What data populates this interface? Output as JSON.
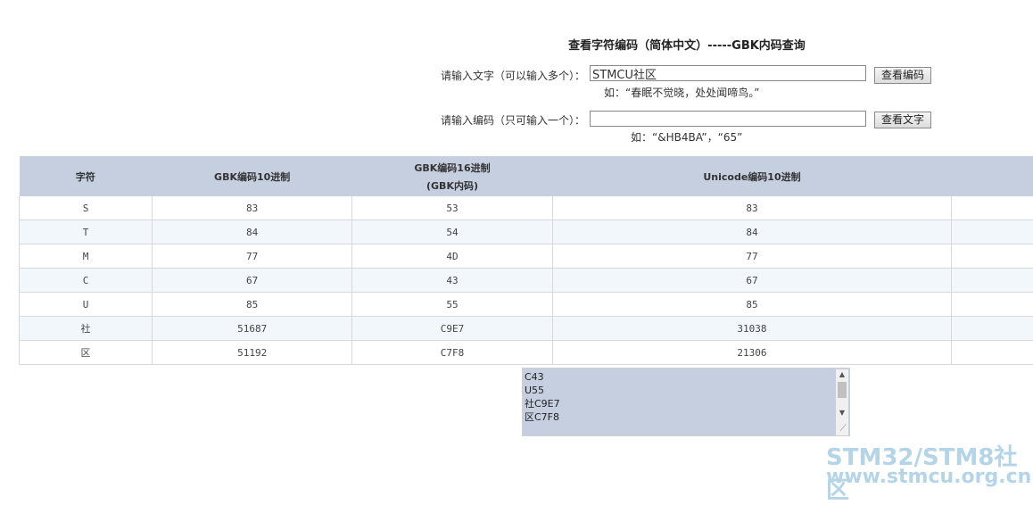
{
  "page": {
    "title": "查看字符编码（简体中文）-----GBK内码查询"
  },
  "form": {
    "text_label": "请输入文字（可以输入多个）：",
    "text_value": "STMCU社区",
    "text_button": "查看编码",
    "text_hint": "如：“春眠不觉晓，处处闻啼鸟。”",
    "code_label": "请输入编码（只可输入一个）：",
    "code_value": "",
    "code_button": "查看文字",
    "code_hint": "如：“&HB4BA”，“65”"
  },
  "table": {
    "headers": {
      "char": "字符",
      "gbk10": "GBK编码10进制",
      "gbk16_line1": "GBK编码16进制",
      "gbk16_line2": "(GBK内码)",
      "unicode10": "Unicode编码10进制",
      "extra": ""
    },
    "rows": [
      {
        "char": "S",
        "gbk10": "83",
        "gbk16": "53",
        "unicode10": "83"
      },
      {
        "char": "T",
        "gbk10": "84",
        "gbk16": "54",
        "unicode10": "84"
      },
      {
        "char": "M",
        "gbk10": "77",
        "gbk16": "4D",
        "unicode10": "77"
      },
      {
        "char": "C",
        "gbk10": "67",
        "gbk16": "43",
        "unicode10": "67"
      },
      {
        "char": "U",
        "gbk10": "85",
        "gbk16": "55",
        "unicode10": "85"
      },
      {
        "char": "社",
        "gbk10": "51687",
        "gbk16": "C9E7",
        "unicode10": "31038"
      },
      {
        "char": "区",
        "gbk10": "51192",
        "gbk16": "C7F8",
        "unicode10": "21306"
      }
    ]
  },
  "output": {
    "lines": [
      "C43",
      "U55",
      "社C9E7",
      "区C7F8"
    ]
  },
  "watermark": {
    "line1": "STM32/STM8社区",
    "line2": "www.stmcu.org.cn"
  }
}
